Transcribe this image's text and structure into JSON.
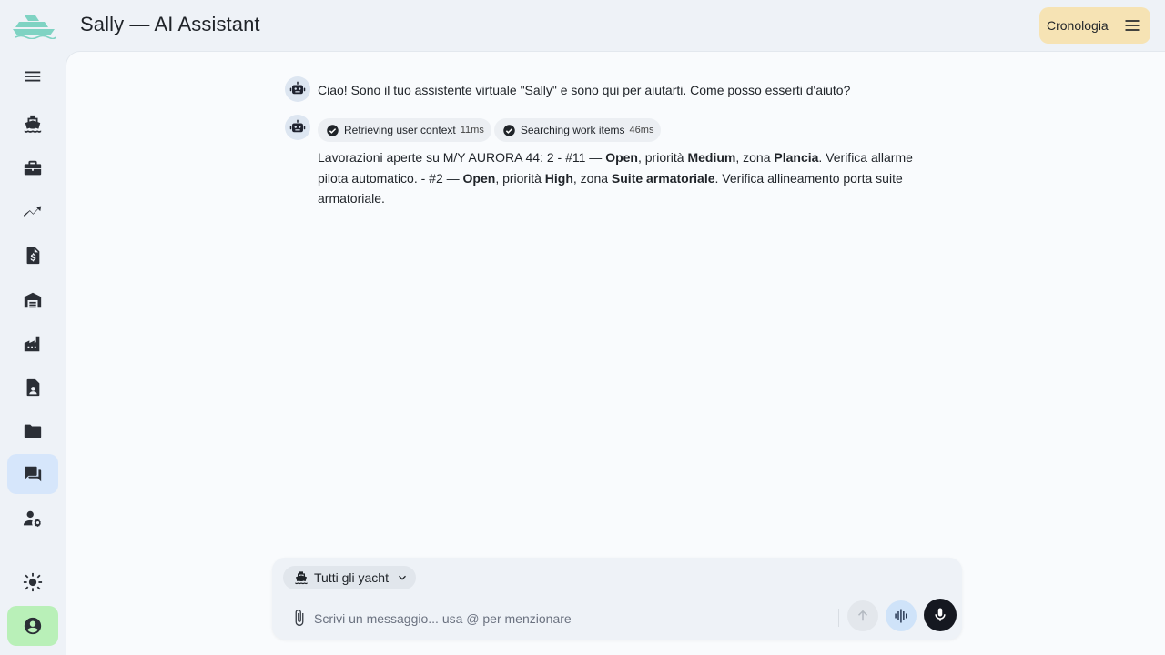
{
  "header": {
    "title": "Sally — AI Assistant",
    "history_label": "Cronologia"
  },
  "sidebar": {
    "items": [
      {
        "name": "menu-icon"
      },
      {
        "name": "ship-icon"
      },
      {
        "name": "briefcase-icon"
      },
      {
        "name": "trending-icon"
      },
      {
        "name": "invoice-icon"
      },
      {
        "name": "warehouse-icon"
      },
      {
        "name": "factory-icon"
      },
      {
        "name": "contact-document-icon"
      },
      {
        "name": "folder-icon"
      },
      {
        "name": "chat-icon",
        "active": true
      },
      {
        "name": "user-settings-icon"
      },
      {
        "name": "sun-icon"
      },
      {
        "name": "account-circle-icon"
      }
    ]
  },
  "chat": {
    "greeting": "Ciao! Sono il tuo assistente virtuale \"Sally\" e sono qui per aiutarti. Come posso esserti d'aiuto?",
    "tools": [
      {
        "label": "Retrieving user context",
        "time": "11ms"
      },
      {
        "label": "Searching work items",
        "time": "46ms"
      }
    ],
    "response": {
      "p1": "Lavorazioni aperte su M/Y AURORA 44: 2 - #11 — ",
      "b1": "Open",
      "p2": ", priorità ",
      "b2": "Medium",
      "p3": ", zona ",
      "b3": "Plancia",
      "p4": ". Verifica allarme pilota automatico. - #2 — ",
      "b4": "Open",
      "p5": ", priorità ",
      "b5": "High",
      "p6": ", zona ",
      "b6": "Suite armatoriale",
      "p7": ". Verifica allineamento porta suite armatoriale."
    }
  },
  "composer": {
    "yacht_filter": "Tutti gli yacht",
    "placeholder": "Scrivi un messaggio... usa @ per menzionare"
  }
}
